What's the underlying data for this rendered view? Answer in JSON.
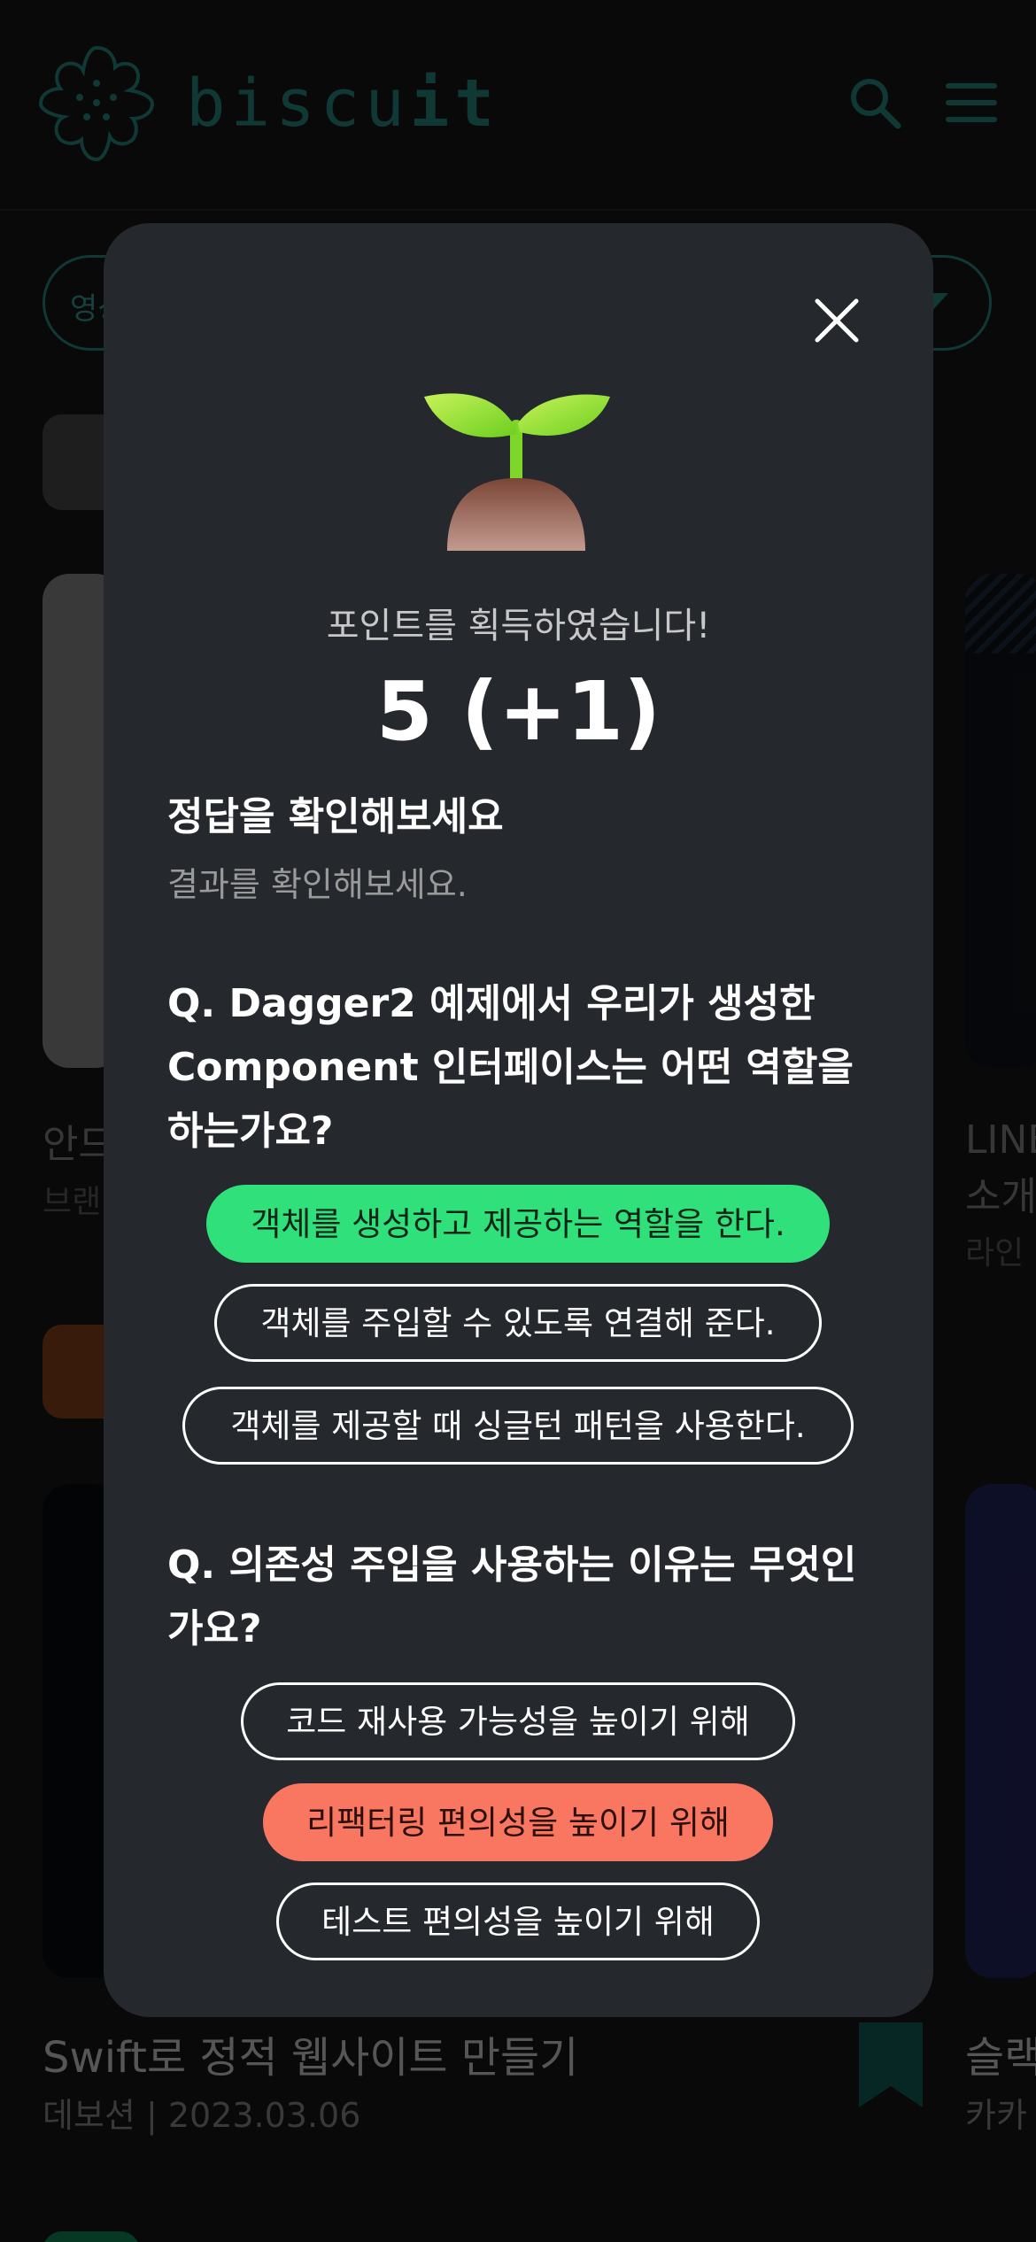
{
  "header": {
    "logo_text": "biscuit",
    "logo_emphasis": "it",
    "logo_prefix": "biscu",
    "icons": [
      "logo-mark-icon",
      "search-icon",
      "menu-icon"
    ]
  },
  "background": {
    "filter_label": "영상",
    "card1_title": "안드",
    "card1_sub": "브랜",
    "card2_title": "LINE",
    "card2_title_line2": "소개",
    "card2_sub": "라인",
    "card3_title": "Swift로 정적 웹사이트 만들기",
    "card3_meta": "데보션 | 2023.03.06",
    "card4_title": "슬랙",
    "card4_sub": "카카"
  },
  "modal": {
    "earned_message": "포인트를 획득하였습니다!",
    "points": "5 (+1)",
    "answer_heading": "정답을 확인해보세요",
    "answer_sub": "결과를 확인해보세요.",
    "questions": [
      {
        "question": "Q. Dagger2 예제에서 우리가 생성한 Component 인터페이스는 어떤 역할을 하는가요?",
        "options": [
          {
            "label": "객체를 생성하고 제공하는 역할을 한다.",
            "state": "correct"
          },
          {
            "label": "객체를 주입할 수 있도록 연결해 준다.",
            "state": "neutral"
          },
          {
            "label": "객체를 제공할 때 싱글턴 패턴을 사용한다.",
            "state": "neutral"
          }
        ]
      },
      {
        "question": "Q. 의존성 주입을 사용하는 이유는 무엇인가요?",
        "options": [
          {
            "label": "코드 재사용 가능성을 높이기 위해",
            "state": "neutral"
          },
          {
            "label": "리팩터링 편의성을 높이기 위해",
            "state": "wrong"
          },
          {
            "label": "테스트 편의성을 높이기 위해",
            "state": "neutral"
          }
        ]
      }
    ]
  },
  "colors": {
    "brand": "#1f6b66",
    "correct": "#2fe07b",
    "wrong": "#f97660",
    "modal_bg": "#25282c"
  }
}
